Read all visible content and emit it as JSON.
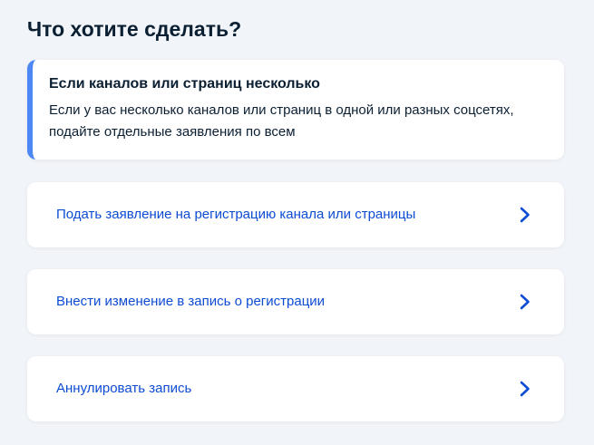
{
  "page": {
    "title": "Что хотите сделать?"
  },
  "info": {
    "title": "Если каналов или страниц несколько",
    "text": "Если у вас несколько каналов или страниц в одной или разных соцсетях, подайте отдельные заявления по всем"
  },
  "options": [
    {
      "label": "Подать заявление на регистрацию канала или страницы",
      "icon": "chevron-right-icon"
    },
    {
      "label": "Внести изменение в запись о регистрации",
      "icon": "chevron-right-icon"
    },
    {
      "label": "Аннулировать запись",
      "icon": "chevron-right-icon"
    }
  ],
  "colors": {
    "accent": "#4d86f5",
    "link": "#0d4cd3",
    "background": "#f1f4f8",
    "text": "#0b1f33"
  }
}
